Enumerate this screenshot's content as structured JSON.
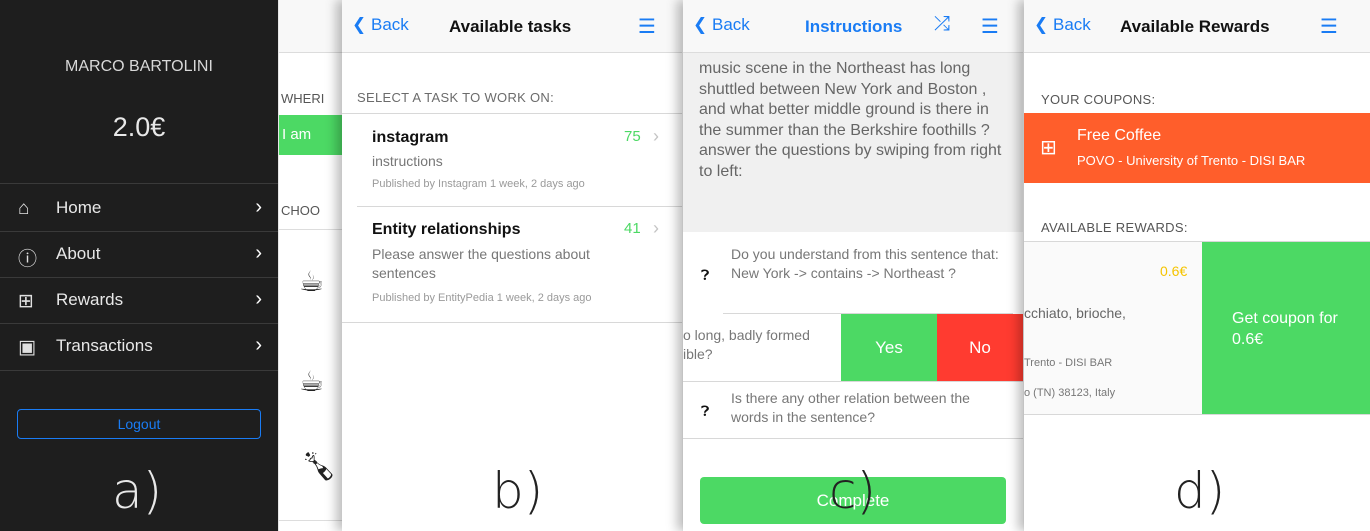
{
  "panel_a": {
    "user_name": "MARCO BARTOLINI",
    "balance": "2.0€",
    "menu": [
      {
        "label": "Home",
        "icon": "home-icon"
      },
      {
        "label": "About",
        "icon": "info-icon"
      },
      {
        "label": "Rewards",
        "icon": "gift-icon"
      },
      {
        "label": "Transactions",
        "icon": "cash-icon"
      }
    ],
    "logout_label": "Logout",
    "figure_label": "a)"
  },
  "sliver": {
    "where_label": "WHERI",
    "iam_label": "I am",
    "choose_label": "CHOO"
  },
  "panel_b": {
    "back": "Back",
    "title": "Available tasks",
    "section_header": "SELECT A TASK TO WORK ON:",
    "tasks": [
      {
        "title": "instagram",
        "points": "75",
        "description": "instructions",
        "published": "Published by Instagram 1 week, 2 days ago"
      },
      {
        "title": "Entity relationships",
        "points": "41",
        "description": "Please answer the questions about sentences",
        "published": "Published by EntityPedia 1 week, 2 days ago"
      }
    ],
    "figure_label": "b)"
  },
  "panel_c": {
    "back": "Back",
    "title": "Instructions",
    "instructions_text": "music scene in the Northeast has long shuttled between New York and Boston , and what better middle ground is there in the summer than the Berkshire foothills ? answer the questions by swiping from right to left:",
    "question1": "Do you understand from this sentence that: New York -> contains -> Northeast ?",
    "question2_partial": "o long, badly formed ible?",
    "yes_label": "Yes",
    "no_label": "No",
    "question3": "Is there any other relation between the words in the sentence?",
    "complete_label": "Complete",
    "figure_label": "c)"
  },
  "panel_d": {
    "back": "Back",
    "title": "Available Rewards",
    "your_coupons_header": "YOUR COUPONS:",
    "coupon": {
      "title": "Free Coffee",
      "place": "POVO - University of Trento - DISI BAR"
    },
    "available_header": "AVAILABLE REWARDS:",
    "reward": {
      "price": "0.6€",
      "desc_partial": "cchiato, brioche,",
      "place_partial": "Trento - DISI BAR",
      "address_partial": "o (TN) 38123, Italy"
    },
    "get_coupon_label": "Get coupon for 0.6€",
    "figure_label": "d)"
  },
  "colors": {
    "accent_blue": "#1a7cf4",
    "green": "#4cd964",
    "red": "#ff3b30",
    "orange": "#ff5e2b",
    "points_green": "#4cd964",
    "price_yellow": "#f5c400"
  }
}
